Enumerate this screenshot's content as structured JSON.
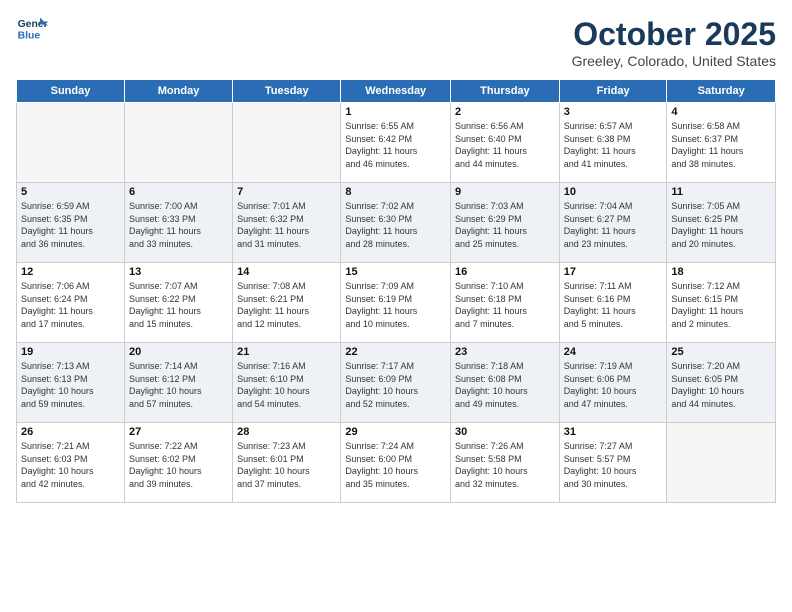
{
  "logo": {
    "line1": "General",
    "line2": "Blue"
  },
  "title": "October 2025",
  "location": "Greeley, Colorado, United States",
  "weekdays": [
    "Sunday",
    "Monday",
    "Tuesday",
    "Wednesday",
    "Thursday",
    "Friday",
    "Saturday"
  ],
  "weeks": [
    [
      {
        "day": "",
        "info": ""
      },
      {
        "day": "",
        "info": ""
      },
      {
        "day": "",
        "info": ""
      },
      {
        "day": "1",
        "info": "Sunrise: 6:55 AM\nSunset: 6:42 PM\nDaylight: 11 hours\nand 46 minutes."
      },
      {
        "day": "2",
        "info": "Sunrise: 6:56 AM\nSunset: 6:40 PM\nDaylight: 11 hours\nand 44 minutes."
      },
      {
        "day": "3",
        "info": "Sunrise: 6:57 AM\nSunset: 6:38 PM\nDaylight: 11 hours\nand 41 minutes."
      },
      {
        "day": "4",
        "info": "Sunrise: 6:58 AM\nSunset: 6:37 PM\nDaylight: 11 hours\nand 38 minutes."
      }
    ],
    [
      {
        "day": "5",
        "info": "Sunrise: 6:59 AM\nSunset: 6:35 PM\nDaylight: 11 hours\nand 36 minutes."
      },
      {
        "day": "6",
        "info": "Sunrise: 7:00 AM\nSunset: 6:33 PM\nDaylight: 11 hours\nand 33 minutes."
      },
      {
        "day": "7",
        "info": "Sunrise: 7:01 AM\nSunset: 6:32 PM\nDaylight: 11 hours\nand 31 minutes."
      },
      {
        "day": "8",
        "info": "Sunrise: 7:02 AM\nSunset: 6:30 PM\nDaylight: 11 hours\nand 28 minutes."
      },
      {
        "day": "9",
        "info": "Sunrise: 7:03 AM\nSunset: 6:29 PM\nDaylight: 11 hours\nand 25 minutes."
      },
      {
        "day": "10",
        "info": "Sunrise: 7:04 AM\nSunset: 6:27 PM\nDaylight: 11 hours\nand 23 minutes."
      },
      {
        "day": "11",
        "info": "Sunrise: 7:05 AM\nSunset: 6:25 PM\nDaylight: 11 hours\nand 20 minutes."
      }
    ],
    [
      {
        "day": "12",
        "info": "Sunrise: 7:06 AM\nSunset: 6:24 PM\nDaylight: 11 hours\nand 17 minutes."
      },
      {
        "day": "13",
        "info": "Sunrise: 7:07 AM\nSunset: 6:22 PM\nDaylight: 11 hours\nand 15 minutes."
      },
      {
        "day": "14",
        "info": "Sunrise: 7:08 AM\nSunset: 6:21 PM\nDaylight: 11 hours\nand 12 minutes."
      },
      {
        "day": "15",
        "info": "Sunrise: 7:09 AM\nSunset: 6:19 PM\nDaylight: 11 hours\nand 10 minutes."
      },
      {
        "day": "16",
        "info": "Sunrise: 7:10 AM\nSunset: 6:18 PM\nDaylight: 11 hours\nand 7 minutes."
      },
      {
        "day": "17",
        "info": "Sunrise: 7:11 AM\nSunset: 6:16 PM\nDaylight: 11 hours\nand 5 minutes."
      },
      {
        "day": "18",
        "info": "Sunrise: 7:12 AM\nSunset: 6:15 PM\nDaylight: 11 hours\nand 2 minutes."
      }
    ],
    [
      {
        "day": "19",
        "info": "Sunrise: 7:13 AM\nSunset: 6:13 PM\nDaylight: 10 hours\nand 59 minutes."
      },
      {
        "day": "20",
        "info": "Sunrise: 7:14 AM\nSunset: 6:12 PM\nDaylight: 10 hours\nand 57 minutes."
      },
      {
        "day": "21",
        "info": "Sunrise: 7:16 AM\nSunset: 6:10 PM\nDaylight: 10 hours\nand 54 minutes."
      },
      {
        "day": "22",
        "info": "Sunrise: 7:17 AM\nSunset: 6:09 PM\nDaylight: 10 hours\nand 52 minutes."
      },
      {
        "day": "23",
        "info": "Sunrise: 7:18 AM\nSunset: 6:08 PM\nDaylight: 10 hours\nand 49 minutes."
      },
      {
        "day": "24",
        "info": "Sunrise: 7:19 AM\nSunset: 6:06 PM\nDaylight: 10 hours\nand 47 minutes."
      },
      {
        "day": "25",
        "info": "Sunrise: 7:20 AM\nSunset: 6:05 PM\nDaylight: 10 hours\nand 44 minutes."
      }
    ],
    [
      {
        "day": "26",
        "info": "Sunrise: 7:21 AM\nSunset: 6:03 PM\nDaylight: 10 hours\nand 42 minutes."
      },
      {
        "day": "27",
        "info": "Sunrise: 7:22 AM\nSunset: 6:02 PM\nDaylight: 10 hours\nand 39 minutes."
      },
      {
        "day": "28",
        "info": "Sunrise: 7:23 AM\nSunset: 6:01 PM\nDaylight: 10 hours\nand 37 minutes."
      },
      {
        "day": "29",
        "info": "Sunrise: 7:24 AM\nSunset: 6:00 PM\nDaylight: 10 hours\nand 35 minutes."
      },
      {
        "day": "30",
        "info": "Sunrise: 7:26 AM\nSunset: 5:58 PM\nDaylight: 10 hours\nand 32 minutes."
      },
      {
        "day": "31",
        "info": "Sunrise: 7:27 AM\nSunset: 5:57 PM\nDaylight: 10 hours\nand 30 minutes."
      },
      {
        "day": "",
        "info": ""
      }
    ]
  ],
  "colors": {
    "header_bg": "#2a6db5",
    "header_text": "#ffffff",
    "title_color": "#1a3a5c",
    "row_alt_bg": "#eef2f7",
    "cell_bg": "#ffffff",
    "empty_bg": "#f5f5f5"
  }
}
